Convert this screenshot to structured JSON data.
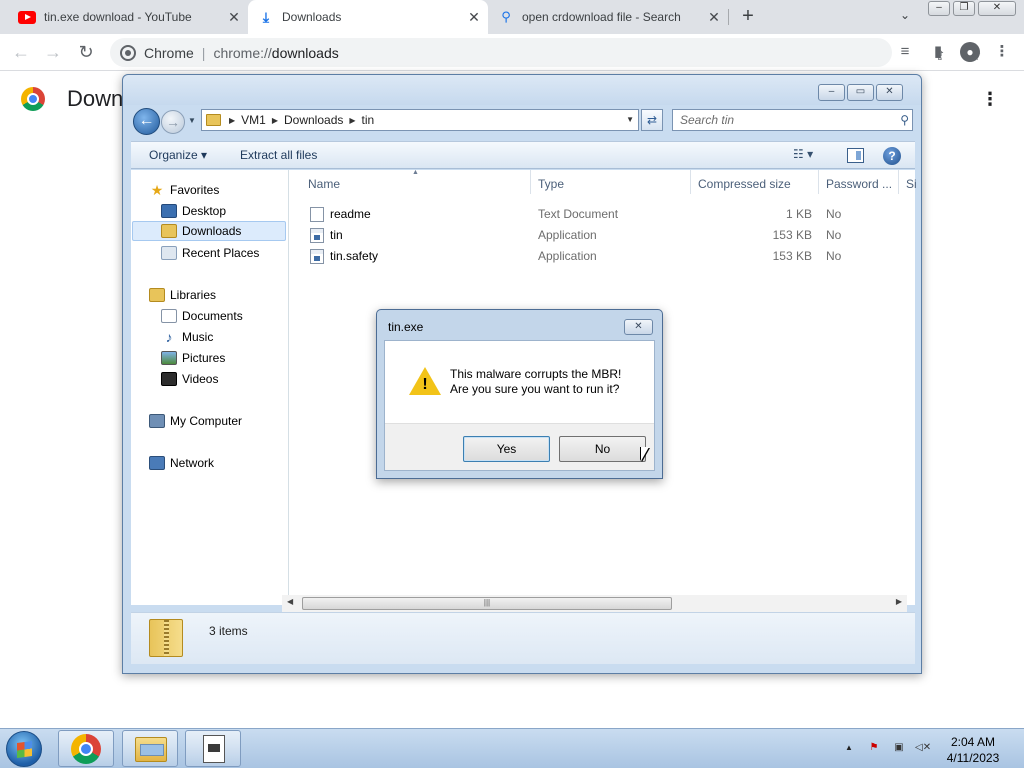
{
  "browser": {
    "tabs": [
      {
        "title": "tin.exe download - YouTube",
        "icon": "youtube-icon",
        "active": false
      },
      {
        "title": "Downloads",
        "icon": "download-icon",
        "active": true
      },
      {
        "title": "open crdownload file - Search",
        "icon": "search-icon",
        "active": false
      }
    ],
    "new_tab_label": "+",
    "omnibox": {
      "origin": "Chrome",
      "separator": "|",
      "url_scheme": "chrome://",
      "url_host": "downloads"
    }
  },
  "downloads_page": {
    "title": "Down"
  },
  "explorer": {
    "breadcrumb": [
      "VM1",
      "Downloads",
      "tin"
    ],
    "search_placeholder": "Search tin",
    "commands": {
      "organize": "Organize",
      "extract": "Extract all files"
    },
    "nav": {
      "favorites": "Favorites",
      "favorites_items": [
        "Desktop",
        "Downloads",
        "Recent Places"
      ],
      "libraries": "Libraries",
      "libraries_items": [
        "Documents",
        "Music",
        "Pictures",
        "Videos"
      ],
      "computer": "My Computer",
      "network": "Network"
    },
    "columns": [
      "Name",
      "Type",
      "Compressed size",
      "Password ...",
      "Si"
    ],
    "files": [
      {
        "name": "readme",
        "type": "Text Document",
        "size": "1 KB",
        "password": "No",
        "kind": "text"
      },
      {
        "name": "tin",
        "type": "Application",
        "size": "153 KB",
        "password": "No",
        "kind": "app"
      },
      {
        "name": "tin.safety",
        "type": "Application",
        "size": "153 KB",
        "password": "No",
        "kind": "app"
      }
    ],
    "status": "3 items"
  },
  "dialog": {
    "title": "tin.exe",
    "message_line1": "This malware corrupts the MBR!",
    "message_line2": "Are you sure you want to run it?",
    "yes": "Yes",
    "no": "No"
  },
  "taskbar": {
    "time": "2:04 AM",
    "date": "4/11/2023"
  },
  "colors": {
    "youtube_red": "#ff0000",
    "chrome_blue": "#1a73e8",
    "warning_yellow": "#f2c318"
  }
}
